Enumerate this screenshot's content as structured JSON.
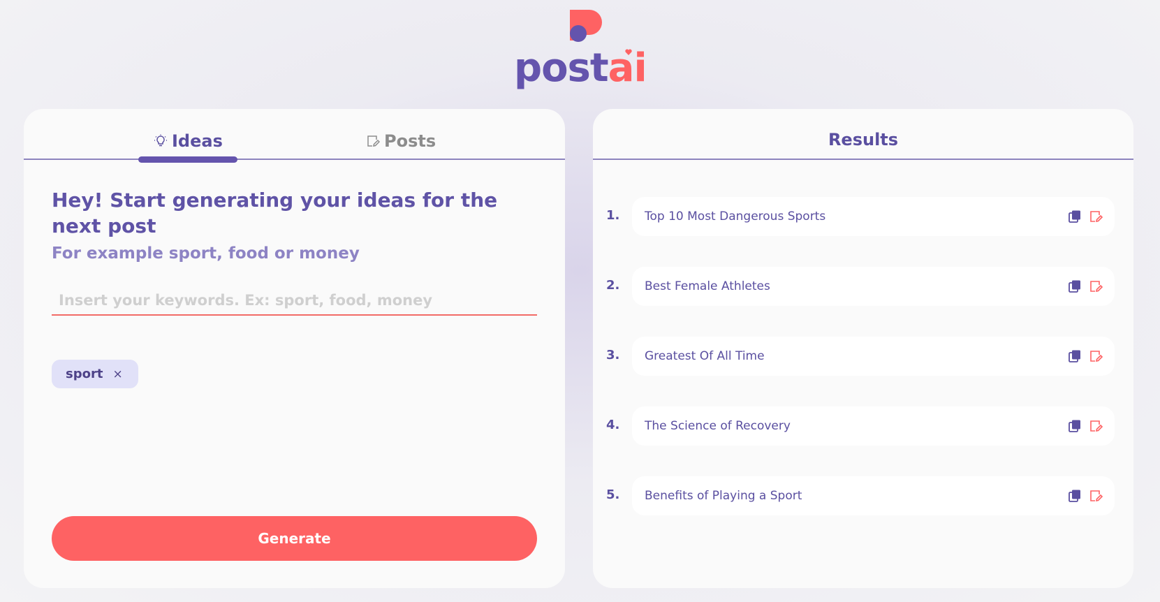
{
  "brand": {
    "part1": "post",
    "part2": "ai",
    "color_primary": "#6454ad",
    "color_accent": "#fe6263"
  },
  "tabs": [
    {
      "label": "Ideas",
      "icon": "lightbulb-icon",
      "active": true
    },
    {
      "label": "Posts",
      "icon": "edit-document-icon",
      "active": false
    }
  ],
  "ideas_panel": {
    "heading": "Hey! Start generating your ideas for the next post",
    "subheading": "For example sport, food or money",
    "input_value": "",
    "input_placeholder": "Insert your keywords. Ex: sport, food, money",
    "chips": [
      "sport"
    ],
    "chip_close": "×",
    "generate_label": "Generate"
  },
  "results": {
    "title": "Results",
    "items": [
      {
        "num": "1.",
        "text": "Top 10 Most Dangerous Sports"
      },
      {
        "num": "2.",
        "text": "Best Female Athletes"
      },
      {
        "num": "3.",
        "text": "Greatest Of All Time"
      },
      {
        "num": "4.",
        "text": "The Science of Recovery"
      },
      {
        "num": "5.",
        "text": "Benefits of Playing a Sport"
      }
    ],
    "copy_icon": "copy-icon",
    "edit_icon": "edit-document-icon"
  }
}
